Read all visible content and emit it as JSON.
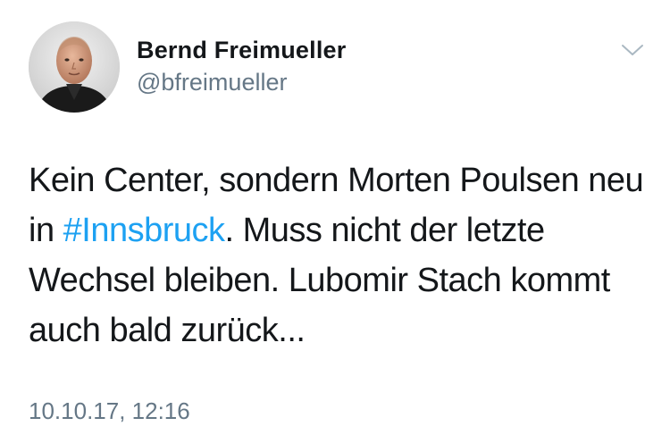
{
  "tweet": {
    "author": {
      "display_name": "Bernd Freimueller",
      "handle": "@bfreimueller",
      "avatar_icon": "profile-photo"
    },
    "text": {
      "part1": "Kein Center, sondern Morten Poulsen neu in ",
      "hashtag": "#Innsbruck",
      "part2": ". Muss nicht der letzte Wechsel bleiben. Lubomir Stach kommt auch bald zurück..."
    },
    "timestamp": "10.10.17, 12:16",
    "menu_icon": "chevron-down-icon"
  },
  "colors": {
    "text": "#14171a",
    "secondary": "#657786",
    "link": "#1da1f2"
  }
}
